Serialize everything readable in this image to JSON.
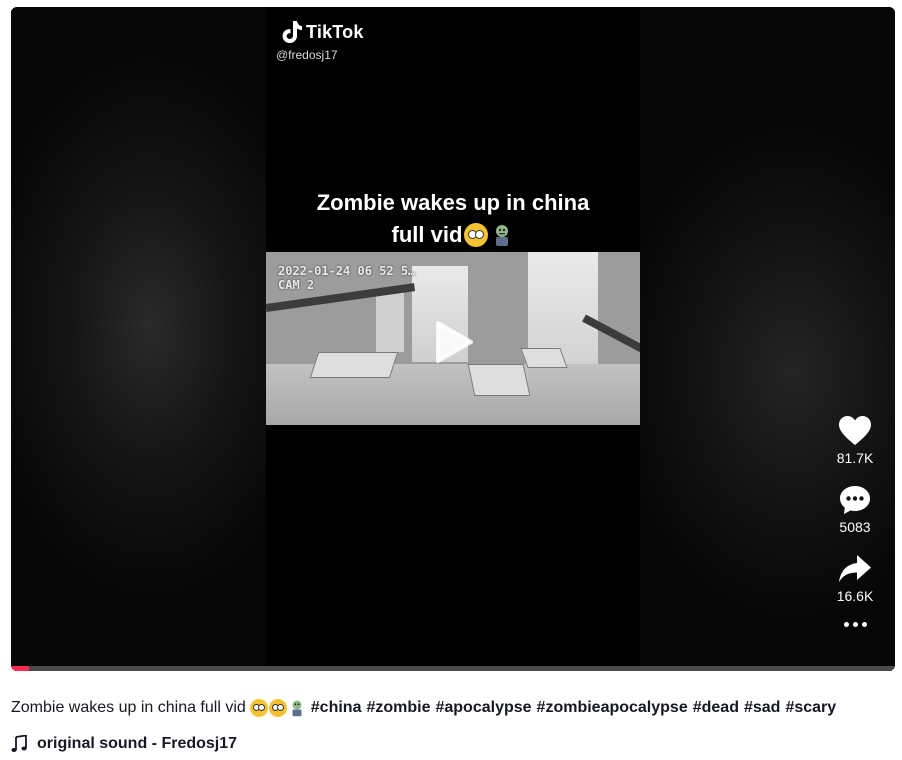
{
  "video": {
    "watermark_brand": "TikTok",
    "watermark_handle": "@fredosj17",
    "overlay_caption_line1": "Zombie wakes up in china",
    "overlay_caption_line2": "full vid",
    "cctv_timestamp": "2022-01-24 06 52 5…",
    "cctv_camera": "CAM 2",
    "progress_fraction": 0.02
  },
  "actions": {
    "likes": "81.7K",
    "comments": "5083",
    "shares": "16.6K"
  },
  "description": {
    "text": "Zombie wakes up in china full vid",
    "hashtags": [
      "#china",
      "#zombie",
      "#apocalypse",
      "#zombieapocalypse",
      "#dead",
      "#sad",
      "#scary"
    ]
  },
  "sound": {
    "label": "original sound - Fredosj17"
  },
  "colors": {
    "progress": "#fe2c55",
    "text": "#161823"
  },
  "icons": [
    "tiktok-logo-icon",
    "play-icon",
    "heart-icon",
    "comment-icon",
    "share-icon",
    "more-icon",
    "music-note-icon"
  ]
}
